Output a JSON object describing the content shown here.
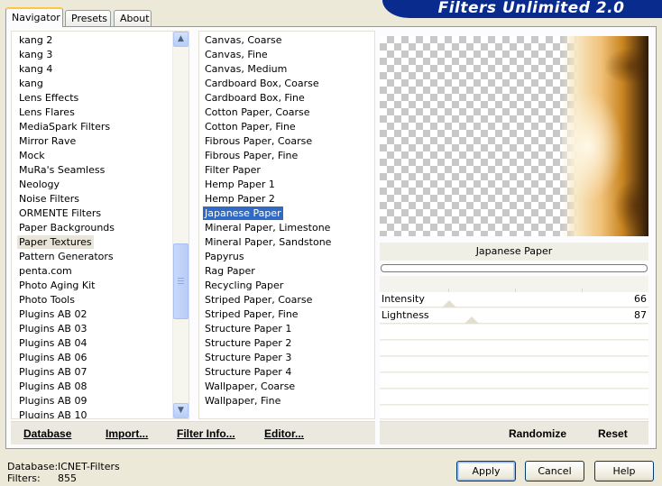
{
  "banner_title": "Filters Unlimited 2.0",
  "tabs": [
    {
      "label": "Navigator"
    },
    {
      "label": "Presets"
    },
    {
      "label": "About"
    }
  ],
  "categories": [
    "kang 2",
    "kang 3",
    "kang 4",
    "kang",
    "Lens Effects",
    "Lens Flares",
    "MediaSpark Filters",
    "Mirror Rave",
    "Mock",
    "MuRa's Seamless",
    "Neology",
    "Noise Filters",
    "ORMENTE Filters",
    "Paper Backgrounds",
    "Paper Textures",
    "Pattern Generators",
    "penta.com",
    "Photo Aging Kit",
    "Photo Tools",
    "Plugins AB 02",
    "Plugins AB 03",
    "Plugins AB 04",
    "Plugins AB 06",
    "Plugins AB 07",
    "Plugins AB 08",
    "Plugins AB 09",
    "Plugins AB 10"
  ],
  "current_category": "Paper Textures",
  "filters": [
    "Canvas, Coarse",
    "Canvas, Fine",
    "Canvas, Medium",
    "Cardboard Box, Coarse",
    "Cardboard Box, Fine",
    "Cotton Paper, Coarse",
    "Cotton Paper, Fine",
    "Fibrous Paper, Coarse",
    "Fibrous Paper, Fine",
    "Filter Paper",
    "Hemp Paper 1",
    "Hemp Paper 2",
    "Japanese Paper",
    "Mineral Paper, Limestone",
    "Mineral Paper, Sandstone",
    "Papyrus",
    "Rag Paper",
    "Recycling Paper",
    "Striped Paper, Coarse",
    "Striped Paper, Fine",
    "Structure Paper 1",
    "Structure Paper 2",
    "Structure Paper 3",
    "Structure Paper 4",
    "Wallpaper, Coarse",
    "Wallpaper, Fine"
  ],
  "selected_filter": "Japanese Paper",
  "preview_filter_name": "Japanese Paper",
  "sliders": [
    {
      "label": "Intensity",
      "value": "66"
    },
    {
      "label": "Lightness",
      "value": "87"
    }
  ],
  "bottom_left": {
    "database": "Database",
    "import": "Import...",
    "filter_info": "Filter Info...",
    "editor": "Editor..."
  },
  "bottom_right": {
    "randomize": "Randomize",
    "reset": "Reset"
  },
  "status": {
    "database_label": "Database:",
    "database_value": "ICNET-Filters",
    "filters_label": "Filters:",
    "filters_value": "855"
  },
  "buttons": {
    "apply": "Apply",
    "cancel": "Cancel",
    "help": "Help"
  },
  "icons": {
    "scroll_up": "chevron-up-icon",
    "scroll_down": "chevron-down-icon"
  }
}
